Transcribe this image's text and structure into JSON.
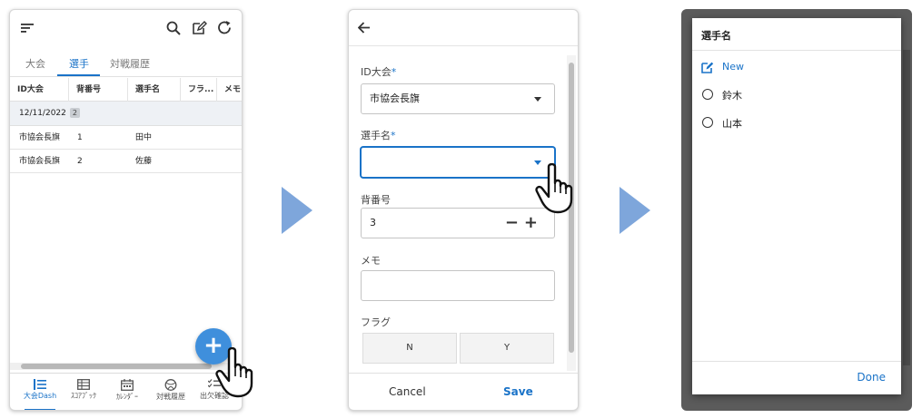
{
  "screen1": {
    "tabs": [
      "大会",
      "選手",
      "対戦履歴"
    ],
    "columns": [
      "ID大会",
      "背番号",
      "選手名",
      "フラ...",
      "メモ"
    ],
    "group": {
      "date": "12/11/2022",
      "count": "2"
    },
    "rows": [
      {
        "tournament": "市協会長旗",
        "number": "1",
        "name": "田中"
      },
      {
        "tournament": "市協会長旗",
        "number": "2",
        "name": "佐藤"
      }
    ],
    "fab_label": "+",
    "nav": [
      "大会Dash",
      "ｽｺｱﾌﾞｯｸ",
      "ｶﾚﾝﾀﾞｰ",
      "対戦履歴",
      "出欠確認"
    ],
    "icons": [
      "sort-icon",
      "search-icon",
      "edit-icon",
      "refresh-icon"
    ]
  },
  "screen2": {
    "tournament_label": "ID大会",
    "required_mark": "*",
    "tournament_value": "市協会長旗",
    "player_label": "選手名",
    "player_value": "",
    "number_label": "背番号",
    "number_value": "3",
    "memo_label": "メモ",
    "memo_value": "",
    "flag_label": "フラグ",
    "flag_options": [
      "N",
      "Y"
    ],
    "cancel_label": "Cancel",
    "save_label": "Save"
  },
  "screen3": {
    "title": "選手名",
    "new_label": "New",
    "options": [
      "鈴木",
      "山本"
    ],
    "done_label": "Done"
  },
  "colors": {
    "accent": "#1a73c8",
    "fab": "#3f8fdc",
    "arrow": "#7ea6db"
  }
}
